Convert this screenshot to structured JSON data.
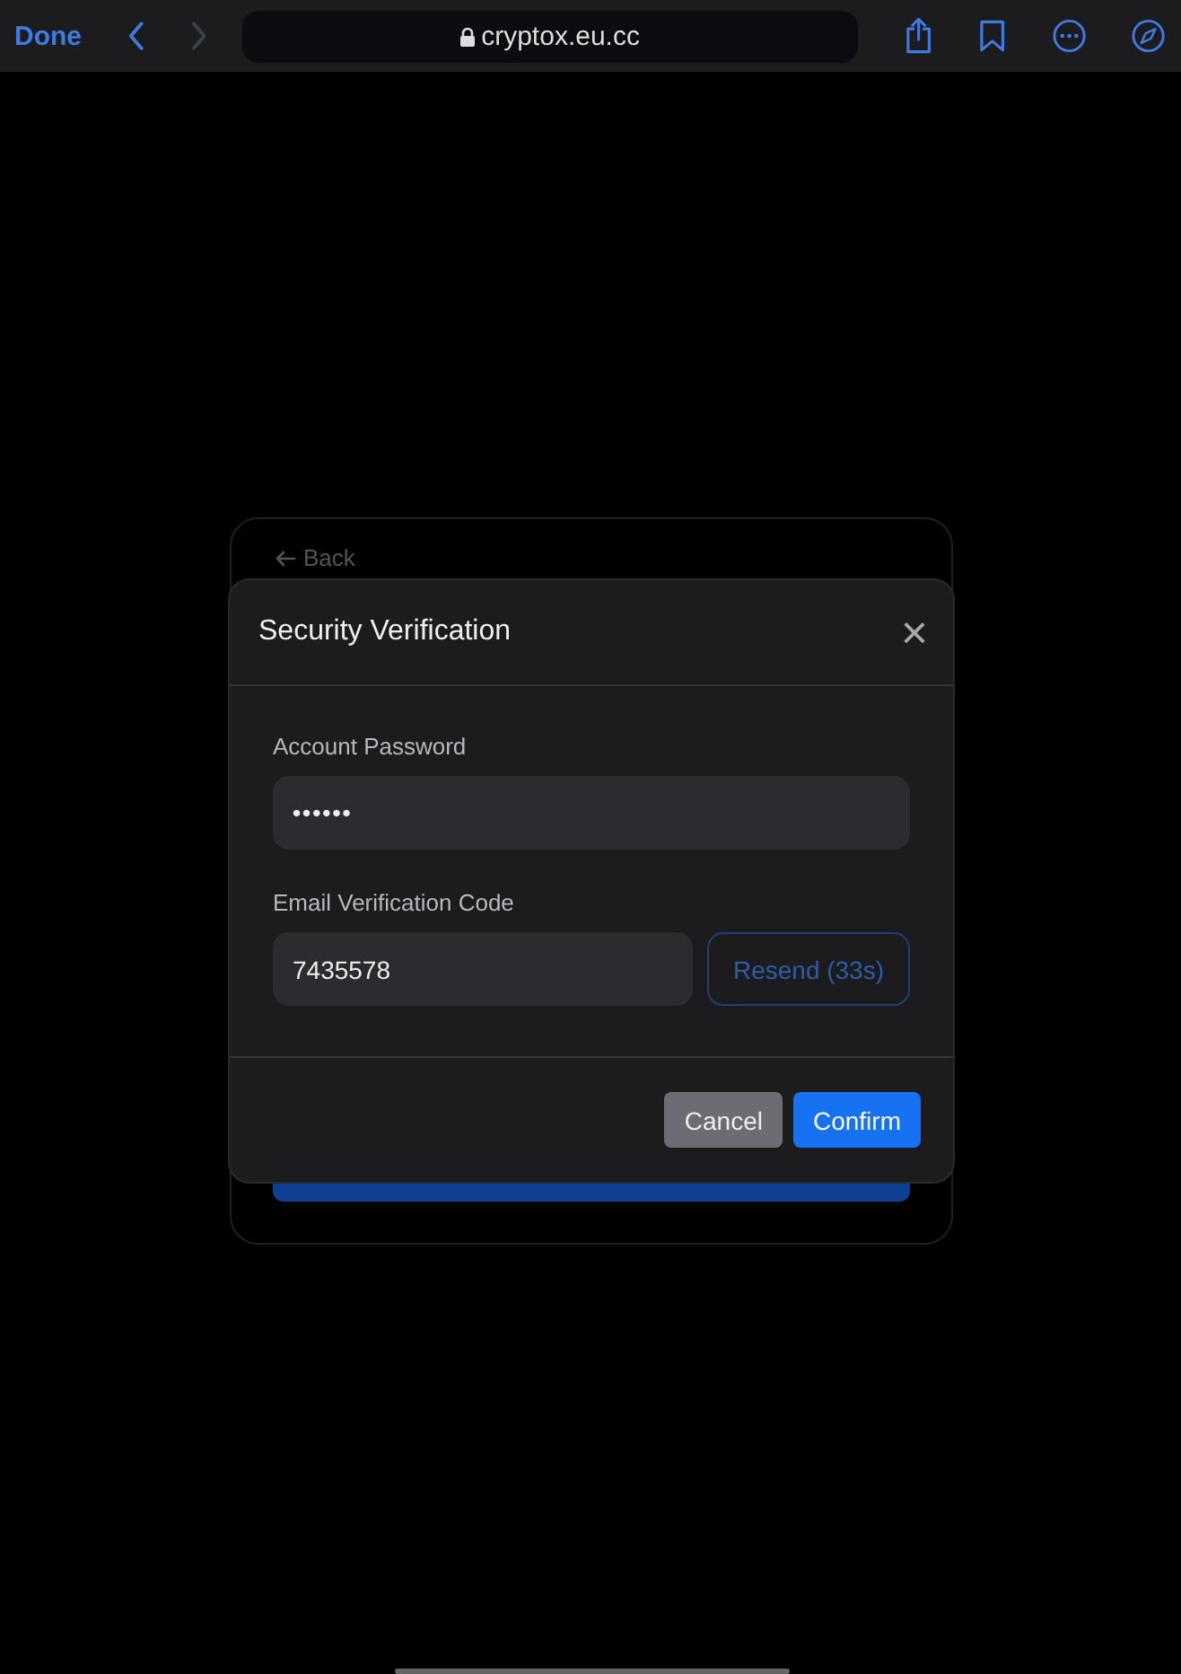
{
  "browser": {
    "done": "Done",
    "url": "cryptox.eu.cc",
    "back_enabled": true,
    "forward_enabled": false
  },
  "page": {
    "back": "Back"
  },
  "dialog": {
    "title": "Security Verification",
    "close": "×",
    "fields": [
      {
        "kind": "password",
        "label": "Account Password",
        "value": "••••••"
      },
      {
        "kind": "code",
        "label": "Email Verification Code",
        "value": "7435578",
        "action": "Resend (33s)"
      }
    ],
    "buttons": [
      {
        "kind": "secondary",
        "label": "Cancel"
      },
      {
        "kind": "primary",
        "label": "Confirm"
      }
    ]
  }
}
